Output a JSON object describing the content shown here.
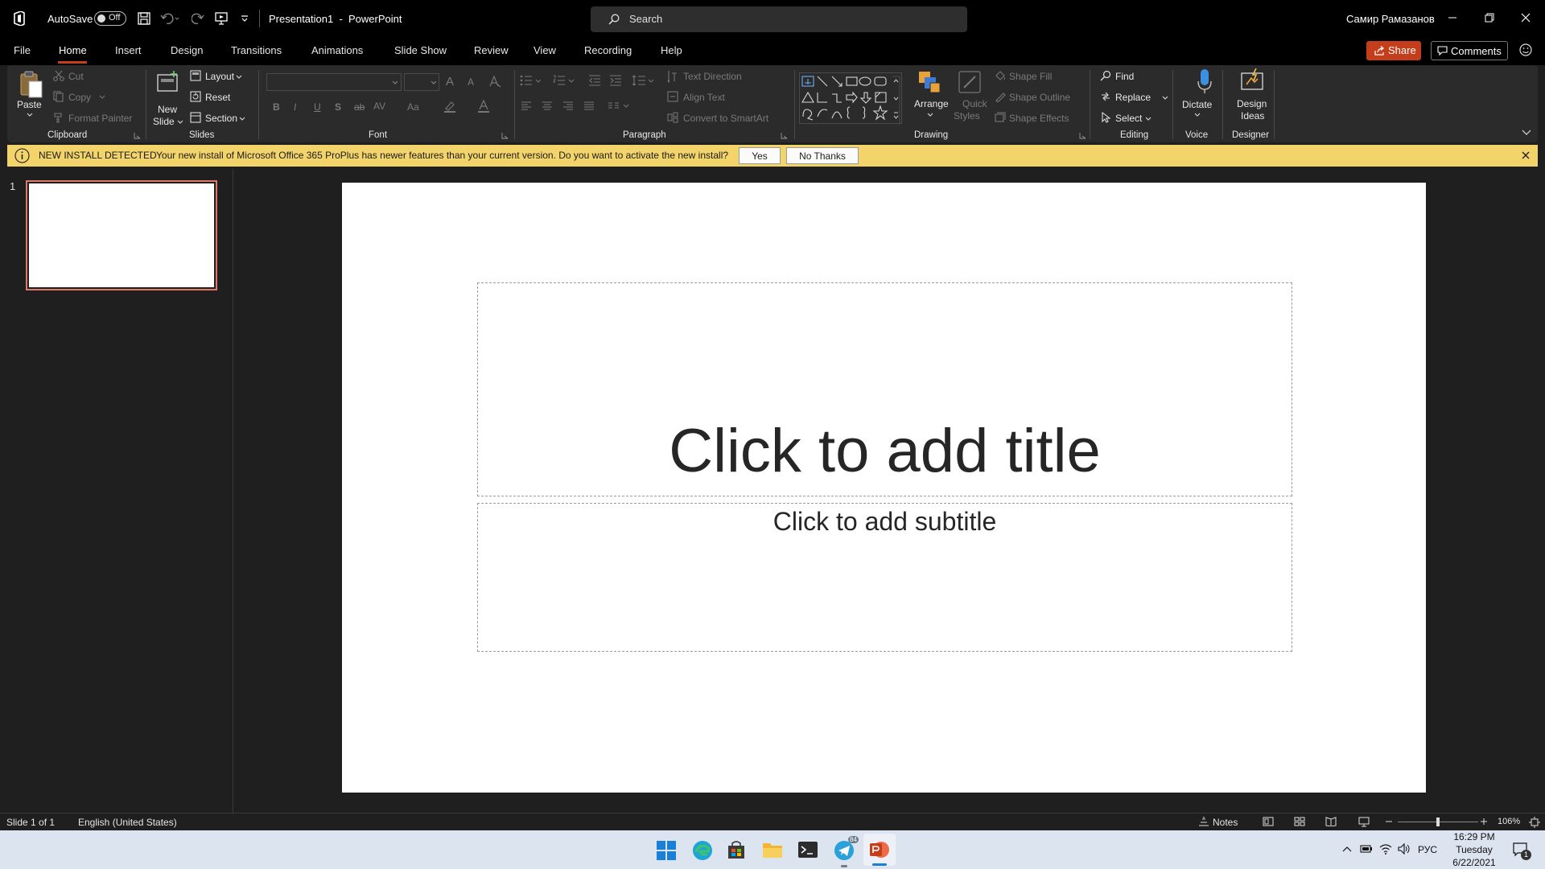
{
  "titlebar": {
    "autosave_label": "AutoSave",
    "autosave_state": "Off",
    "document_title": "Presentation1  -  PowerPoint",
    "search_placeholder": "Search",
    "user_name": "Самир Рамазанов"
  },
  "menu": {
    "tabs": [
      "File",
      "Home",
      "Insert",
      "Design",
      "Transitions",
      "Animations",
      "Slide Show",
      "Review",
      "View",
      "Recording",
      "Help"
    ],
    "active_tab": "Home",
    "share_label": "Share",
    "comments_label": "Comments"
  },
  "ribbon": {
    "clipboard": {
      "paste": "Paste",
      "cut": "Cut",
      "copy": "Copy",
      "format_painter": "Format Painter",
      "label": "Clipboard"
    },
    "slides": {
      "new_slide_1": "New",
      "new_slide_2": "Slide",
      "layout": "Layout",
      "reset": "Reset",
      "section": "Section",
      "label": "Slides"
    },
    "font": {
      "bold": "B",
      "italic": "I",
      "underline": "U",
      "shadow": "S",
      "strike": "ab",
      "spacing": "AV",
      "case": "Aa",
      "grow": "A",
      "shrink": "A",
      "label": "Font"
    },
    "paragraph": {
      "text_direction": "Text Direction",
      "align_text": "Align Text",
      "convert_smartart": "Convert to SmartArt",
      "label": "Paragraph"
    },
    "drawing": {
      "arrange": "Arrange",
      "quick_styles_1": "Quick",
      "quick_styles_2": "Styles",
      "shape_fill": "Shape Fill",
      "shape_outline": "Shape Outline",
      "shape_effects": "Shape Effects",
      "label": "Drawing"
    },
    "editing": {
      "find": "Find",
      "replace": "Replace",
      "select": "Select",
      "label": "Editing"
    },
    "voice": {
      "dictate": "Dictate",
      "label": "Voice"
    },
    "designer": {
      "design_ideas_1": "Design",
      "design_ideas_2": "Ideas",
      "label": "Designer"
    }
  },
  "notification": {
    "title": "NEW INSTALL DETECTED",
    "message": "Your new install of Microsoft Office 365 ProPlus has newer features than your current version. Do you want to activate the new install?",
    "yes": "Yes",
    "no_thanks": "No Thanks"
  },
  "thumbnails": [
    {
      "number": "1"
    }
  ],
  "slide": {
    "title_placeholder": "Click to add title",
    "subtitle_placeholder": "Click to add subtitle"
  },
  "statusbar": {
    "slide_info": "Slide 1 of 1",
    "language": "English (United States)",
    "notes": "Notes",
    "zoom": "106%"
  },
  "taskbar": {
    "lang": "РУС",
    "time": "16:29 PM",
    "day": "Tuesday",
    "date": "6/22/2021",
    "notification_count": "1",
    "telegram_badge": "84"
  },
  "colors": {
    "accent": "#c43e1c",
    "notification_bg": "#f2d46b",
    "ribbon_bg": "#2b2b2b",
    "window_bg": "#1f1f1f"
  }
}
